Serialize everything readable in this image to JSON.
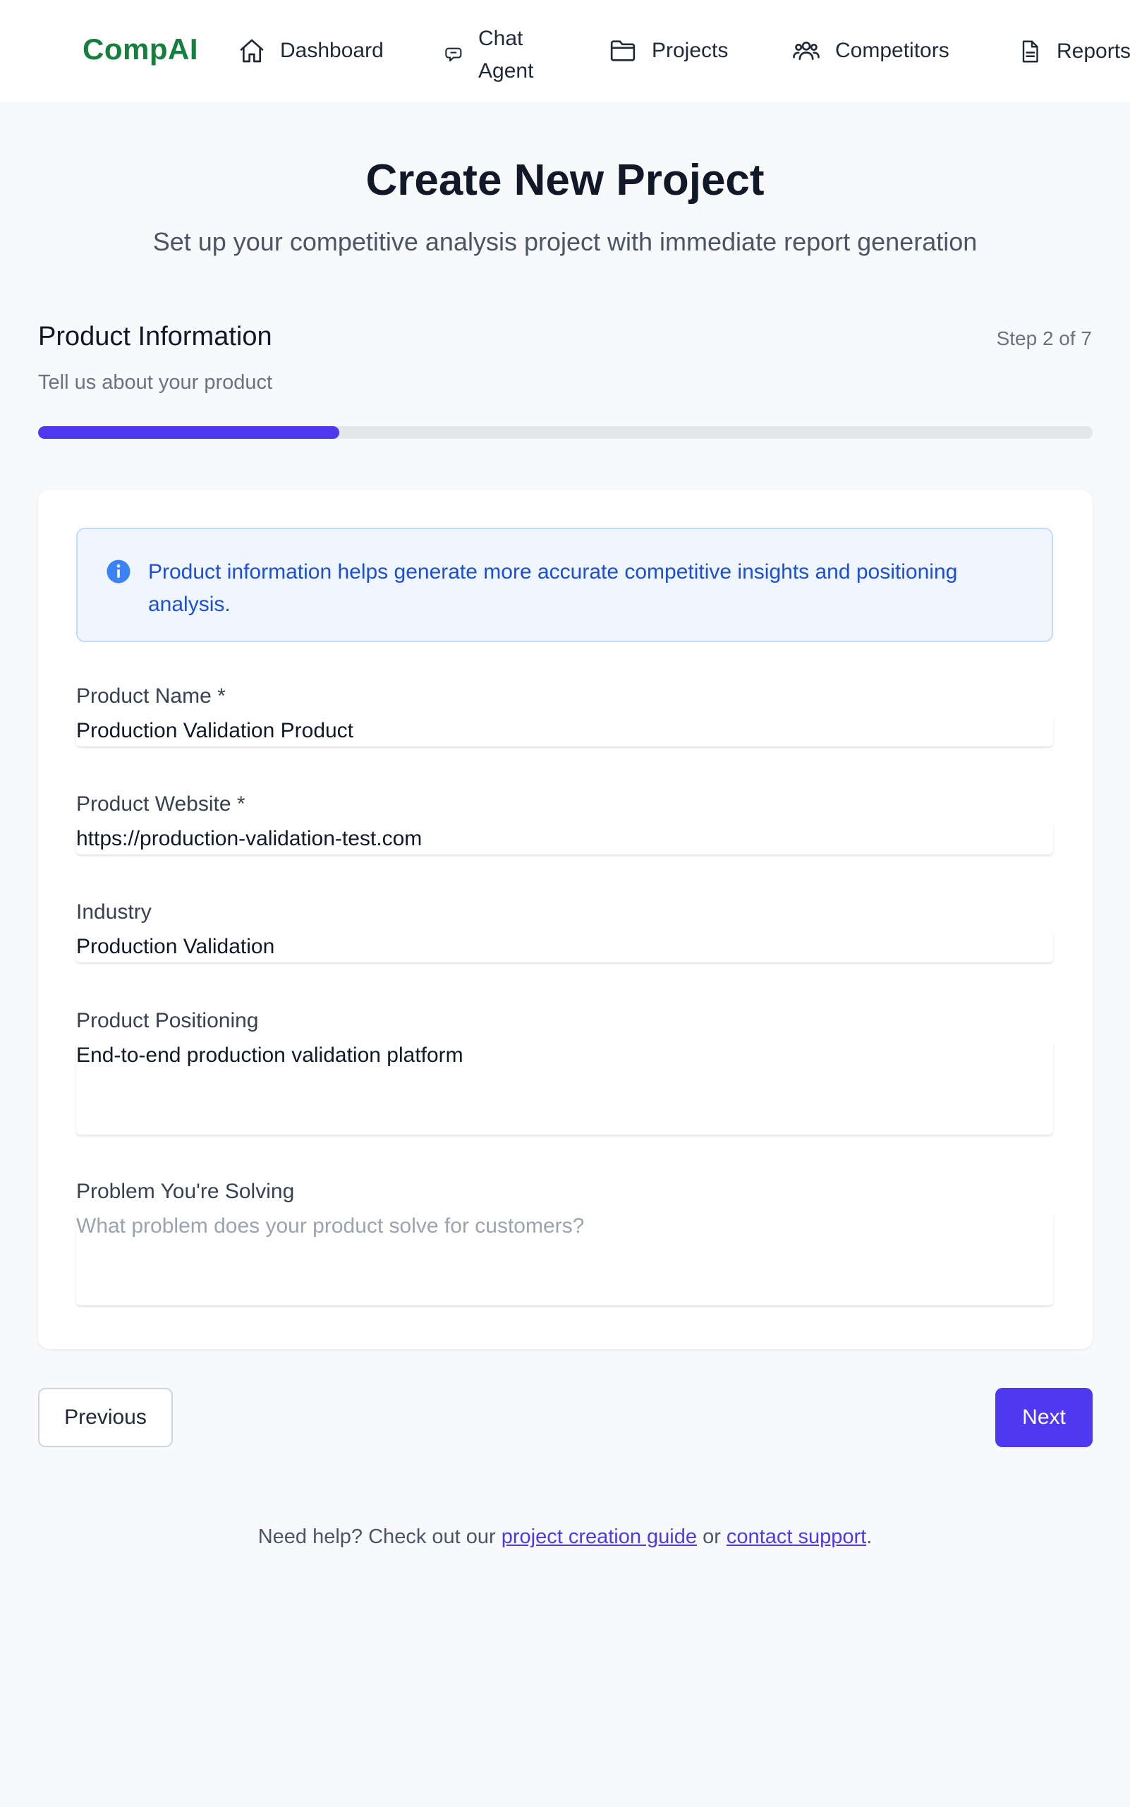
{
  "app": {
    "logo": "CompAI",
    "accent_color": "#4f39f0",
    "brand_color": "#15803d"
  },
  "nav": {
    "items": [
      {
        "label": "Dashboard",
        "icon": "home-icon"
      },
      {
        "label_line1": "Chat",
        "label_line2": "Agent",
        "icon": "chat-icon"
      },
      {
        "label": "Projects",
        "icon": "folder-icon"
      },
      {
        "label": "Competitors",
        "icon": "users-icon"
      },
      {
        "label": "Reports",
        "icon": "document-icon"
      }
    ]
  },
  "page": {
    "title": "Create New Project",
    "subtitle": "Set up your competitive analysis project with immediate report generation"
  },
  "step": {
    "title": "Product Information",
    "description": "Tell us about your product",
    "counter": "Step 2 of 7",
    "current": 2,
    "total": 7,
    "progress_fraction": 0.2857
  },
  "info": {
    "text": "Product information helps generate more accurate competitive insights and positioning analysis.",
    "icon": "info-icon"
  },
  "form": {
    "product_name": {
      "label": "Product Name *",
      "value": "Production Validation Product"
    },
    "product_website": {
      "label": "Product Website *",
      "value": "https://production-validation-test.com"
    },
    "industry": {
      "label": "Industry",
      "value": "Production Validation"
    },
    "positioning": {
      "label": "Product Positioning",
      "value": "End-to-end production validation platform"
    },
    "problem": {
      "label": "Problem You're Solving",
      "value": "",
      "placeholder": "What problem does your product solve for customers?"
    }
  },
  "buttons": {
    "previous": "Previous",
    "next": "Next"
  },
  "help": {
    "prefix": "Need help? Check out our ",
    "guide_link": "project creation guide",
    "middle": " or ",
    "support_link": "contact support",
    "suffix": "."
  }
}
